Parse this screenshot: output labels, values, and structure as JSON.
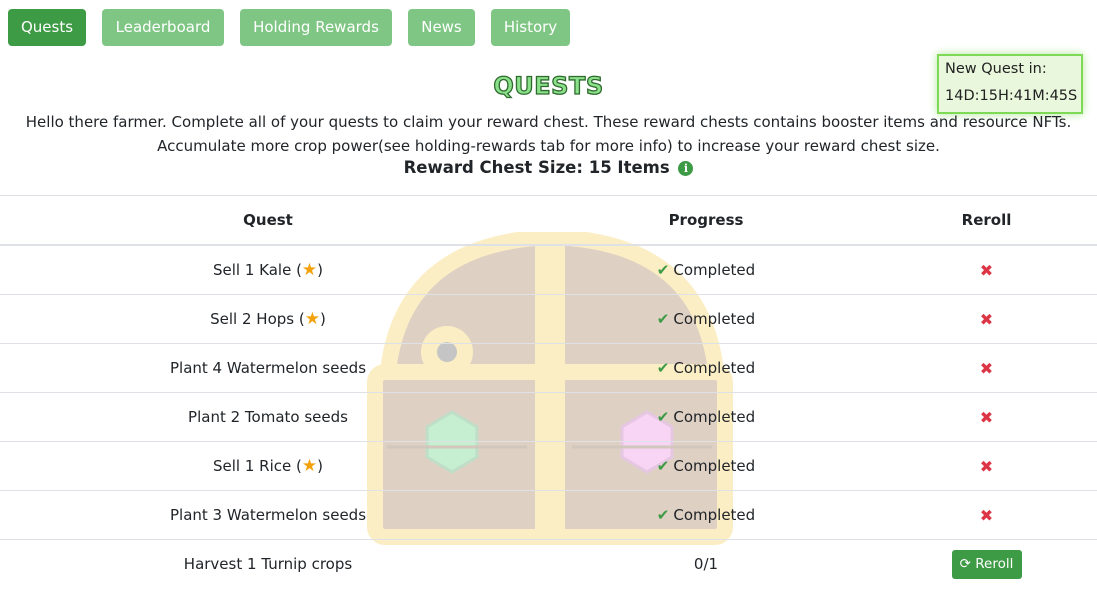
{
  "tabs": [
    "Quests",
    "Leaderboard",
    "Holding Rewards",
    "News",
    "History"
  ],
  "active_tab": "Quests",
  "timer": {
    "label": "New Quest in:",
    "value": "14D:15H:41M:45S"
  },
  "title": "QUESTS",
  "intro": {
    "line1": "Hello there farmer. Complete all of your quests to claim your reward chest. These reward chests contains booster items and resource NFTs.",
    "line2": "Accumulate more crop power(see holding-rewards tab for more info) to increase your reward chest size."
  },
  "chest_size": "Reward Chest Size: 15 Items",
  "table": {
    "headers": [
      "Quest",
      "Progress",
      "Reroll"
    ],
    "rows": [
      {
        "quest": "Sell 1 Kale",
        "star": true,
        "progress": "Completed",
        "completed": true
      },
      {
        "quest": "Sell 2 Hops",
        "star": true,
        "progress": "Completed",
        "completed": true
      },
      {
        "quest": "Plant 4 Watermelon seeds",
        "star": false,
        "progress": "Completed",
        "completed": true
      },
      {
        "quest": "Plant 2 Tomato seeds",
        "star": false,
        "progress": "Completed",
        "completed": true
      },
      {
        "quest": "Sell 1 Rice",
        "star": true,
        "progress": "Completed",
        "completed": true
      },
      {
        "quest": "Plant 3 Watermelon seeds",
        "star": false,
        "progress": "Completed",
        "completed": true
      },
      {
        "quest": "Harvest 1 Turnip crops",
        "star": false,
        "progress": "0/1",
        "completed": false
      }
    ],
    "reroll_label": "Reroll"
  },
  "icons": {
    "star": "star-icon",
    "check": "check-icon",
    "x": "x-icon",
    "refresh": "refresh-icon",
    "info": "info-icon"
  },
  "colors": {
    "active_tab": "#3d9a45",
    "tab": "#7fc684",
    "check": "#3d9a45",
    "x": "#dc3545",
    "star": "#f3a20b"
  }
}
